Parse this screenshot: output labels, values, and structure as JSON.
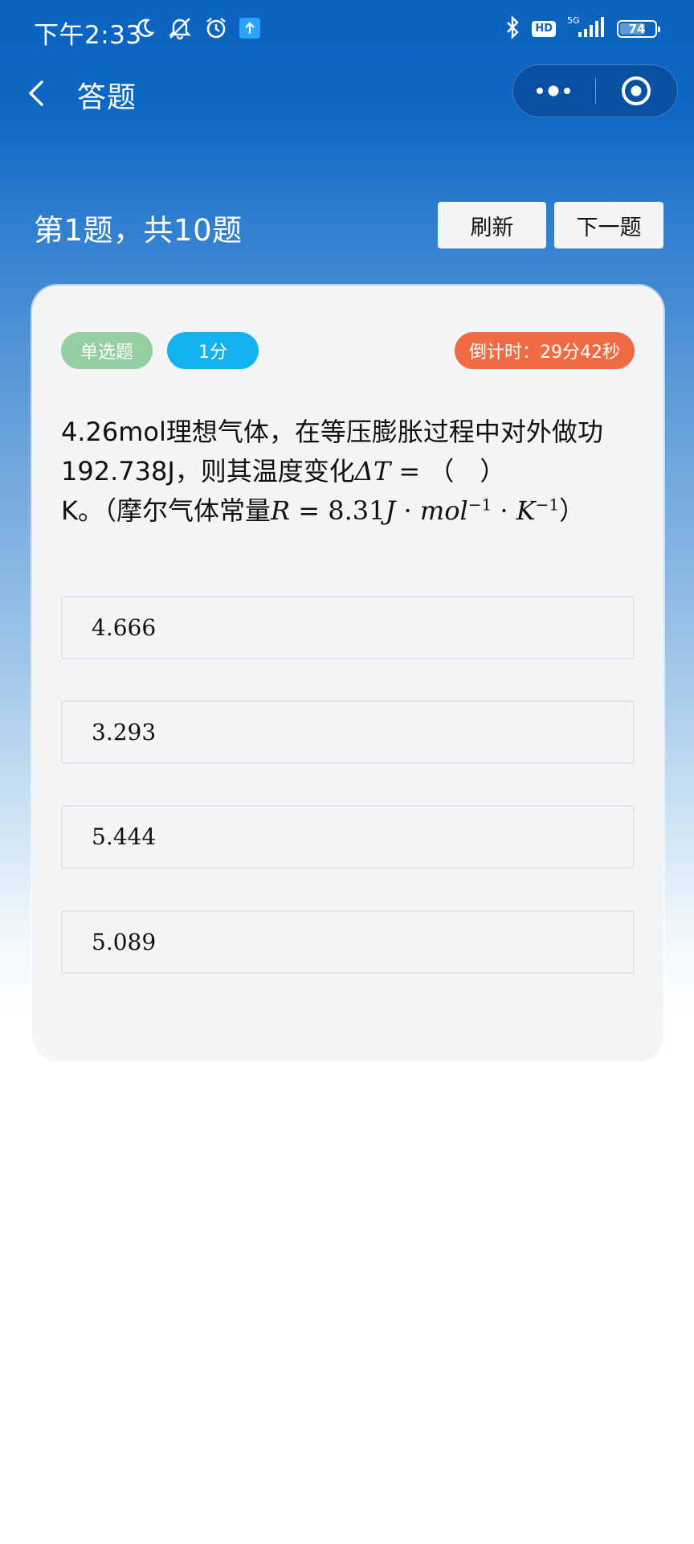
{
  "status_bar": {
    "time": "下午2:33",
    "network": "5G",
    "hd": "HD",
    "battery_level": 74
  },
  "nav": {
    "title": "答题"
  },
  "header": {
    "progress": "第1题，共10题",
    "refresh_label": "刷新",
    "next_label": "下一题"
  },
  "card": {
    "type_badge": "单选题",
    "score_badge": "1分",
    "timer_badge": "倒计时：29分42秒",
    "question": {
      "part1": "4.26mol理想气体，在等压膨胀过程中对外做功192.738J，则其温度变化",
      "delta_t": "ΔT",
      "equals": " = ",
      "blank": "（　）",
      "part2": "K。（摩尔气体常量",
      "r_expr_prefix": "R",
      "r_expr_value": " = 8.31",
      "r_unit_j": "J",
      "r_dot1": " · ",
      "r_unit_mol": "mol",
      "r_exp1": "−1",
      "r_dot2": " · ",
      "r_unit_k": "K",
      "r_exp2": "−1",
      "close_paren": "）"
    },
    "options": [
      "4.666",
      "3.293",
      "5.444",
      "5.089"
    ]
  },
  "colors": {
    "header_blue": "#0b63c0",
    "badge_type": "#93cfa0",
    "badge_score": "#12b3ef",
    "badge_timer": "#f06a43",
    "card_bg": "#f4f5f7"
  }
}
